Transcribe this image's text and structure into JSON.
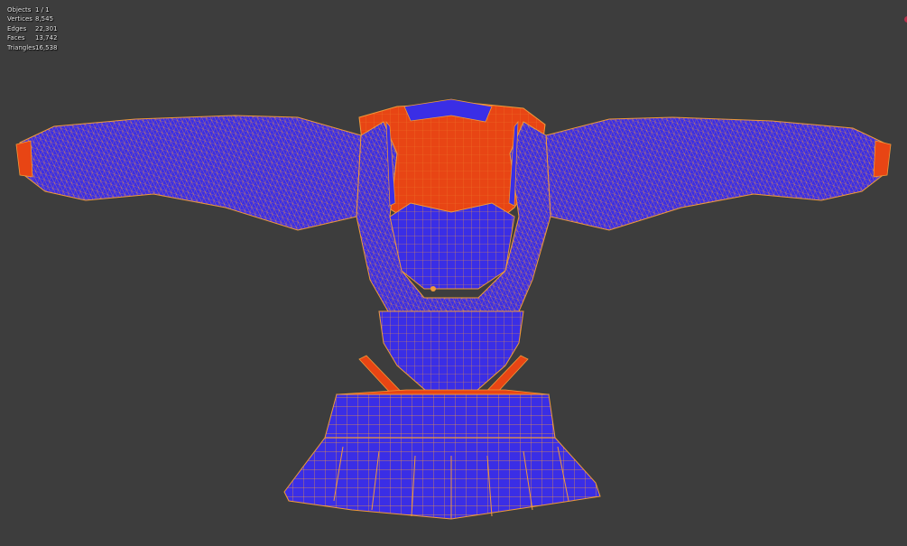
{
  "viewport": {
    "background": "#3d3d3d",
    "mesh_face_color": "#3a2ee6",
    "mesh_backface_color": "#e84514",
    "wire_color": "#f09a3a"
  },
  "statistics": [
    {
      "label": "Objects",
      "value": "1 / 1"
    },
    {
      "label": "Vertices",
      "value": "8,545"
    },
    {
      "label": "Edges",
      "value": "22,301"
    },
    {
      "label": "Faces",
      "value": "13,742"
    },
    {
      "label": "Triangles",
      "value": "16,538"
    }
  ],
  "icons": {
    "corner": "navigation-gizmo-icon"
  }
}
